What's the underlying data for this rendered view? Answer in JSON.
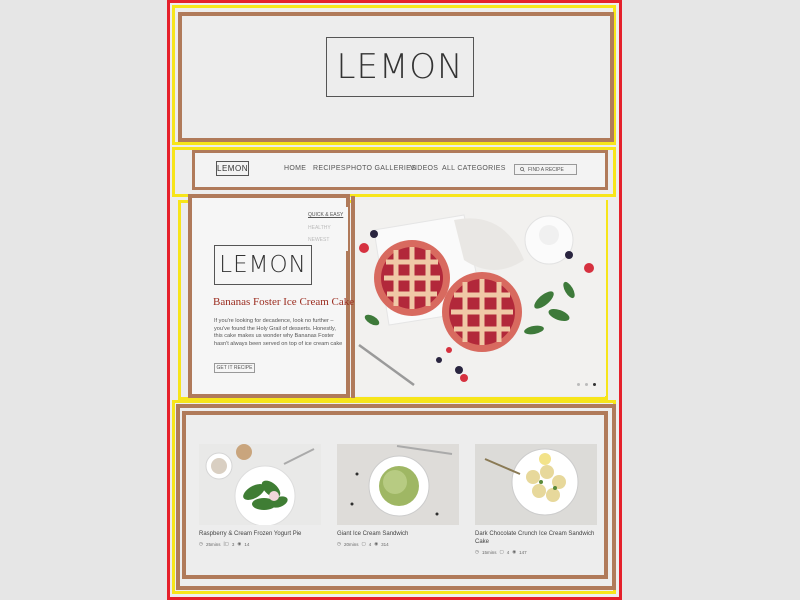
{
  "brand": {
    "logo_text": "LEMON",
    "small_logo_text": "LEMON"
  },
  "nav": {
    "items": [
      "HOME",
      "RECIPES",
      "PHOTO GALLERIES",
      "VIDEOS",
      "ALL CATEGORIES"
    ],
    "search_placeholder": "FIND A RECIPE"
  },
  "dropdown": {
    "items": [
      "QUICK & EASY",
      "HEALTHY",
      "NEWEST"
    ]
  },
  "hero": {
    "logo_text": "LEMON",
    "title": "Bananas Foster Ice Cream Cake",
    "text": "If you're looking for decadence, look no further – you've found the Holy Grail of desserts. Honestly, this cake makes us wonder why Bananas Foster hasn't always been served on top of ice cream cake",
    "button": "GET IT RECIPE",
    "slider_dots": 3,
    "active_dot": 2
  },
  "cards": [
    {
      "title": "Raspberry & Cream Frozen Yogurt Pie",
      "time": "25mins",
      "comments": "3",
      "views": "14"
    },
    {
      "title": "Giant Ice Cream Sandwich",
      "time": "20mins",
      "comments": "4",
      "views": "314"
    },
    {
      "title": "Dark Chocolate Crunch Ice Cream Sandwich Cake",
      "time": "15mins",
      "comments": "4",
      "views": "147"
    }
  ],
  "colors": {
    "annotation_red": "#e5202b",
    "annotation_yellow": "#f7e51a",
    "annotation_brown": "#b07a5a",
    "title_red": "#9b2c1f"
  }
}
